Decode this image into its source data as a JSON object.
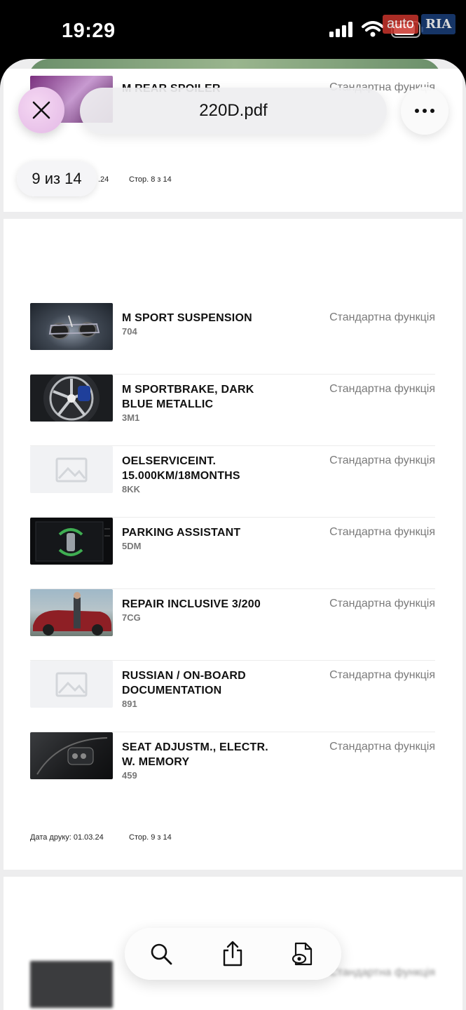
{
  "status_bar": {
    "time": "19:29"
  },
  "watermark": {
    "auto": "auto",
    "ria": "RIA"
  },
  "viewer": {
    "file_title": "220D.pdf",
    "page_counter": "9 из 14"
  },
  "prev_page": {
    "partial_item_title": "M REAR SPOILER",
    "partial_item_status": "Стандартна функція",
    "footer_date_fragment": ".24",
    "footer_page": "Стор. 8 з 14"
  },
  "items": [
    {
      "title": "M SPORT SUSPENSION",
      "code": "704",
      "status": "Стандартна функція",
      "thumb": "suspension"
    },
    {
      "title": "M SPORTBRAKE, DARK BLUE METALLIC",
      "code": "3M1",
      "status": "Стандартна функція",
      "thumb": "brake"
    },
    {
      "title": "OELSERVICEINT. 15.000KM/18MONTHS",
      "code": "8KK",
      "status": "Стандартна функція",
      "thumb": "placeholder"
    },
    {
      "title": "PARKING ASSISTANT",
      "code": "5DM",
      "status": "Стандартна функція",
      "thumb": "parking"
    },
    {
      "title": "REPAIR INCLUSIVE 3/200",
      "code": "7CG",
      "status": "Стандартна функція",
      "thumb": "repair"
    },
    {
      "title": "RUSSIAN / ON-BOARD DOCUMENTATION",
      "code": "891",
      "status": "Стандартна функція",
      "thumb": "placeholder"
    },
    {
      "title": "SEAT ADJUSTM., ELECTR. W. MEMORY",
      "code": "459",
      "status": "Стандартна функція",
      "thumb": "seat"
    }
  ],
  "page_footer": {
    "print_date": "Дата друку: 01.03.24",
    "page": "Стор. 9 з 14"
  },
  "next_page": {
    "partial_item_status": "Стандартна функція"
  },
  "icons": {
    "close": "close-icon",
    "more": "more-icon",
    "search": "search-icon",
    "share": "share-icon",
    "markup": "markup-icon"
  }
}
